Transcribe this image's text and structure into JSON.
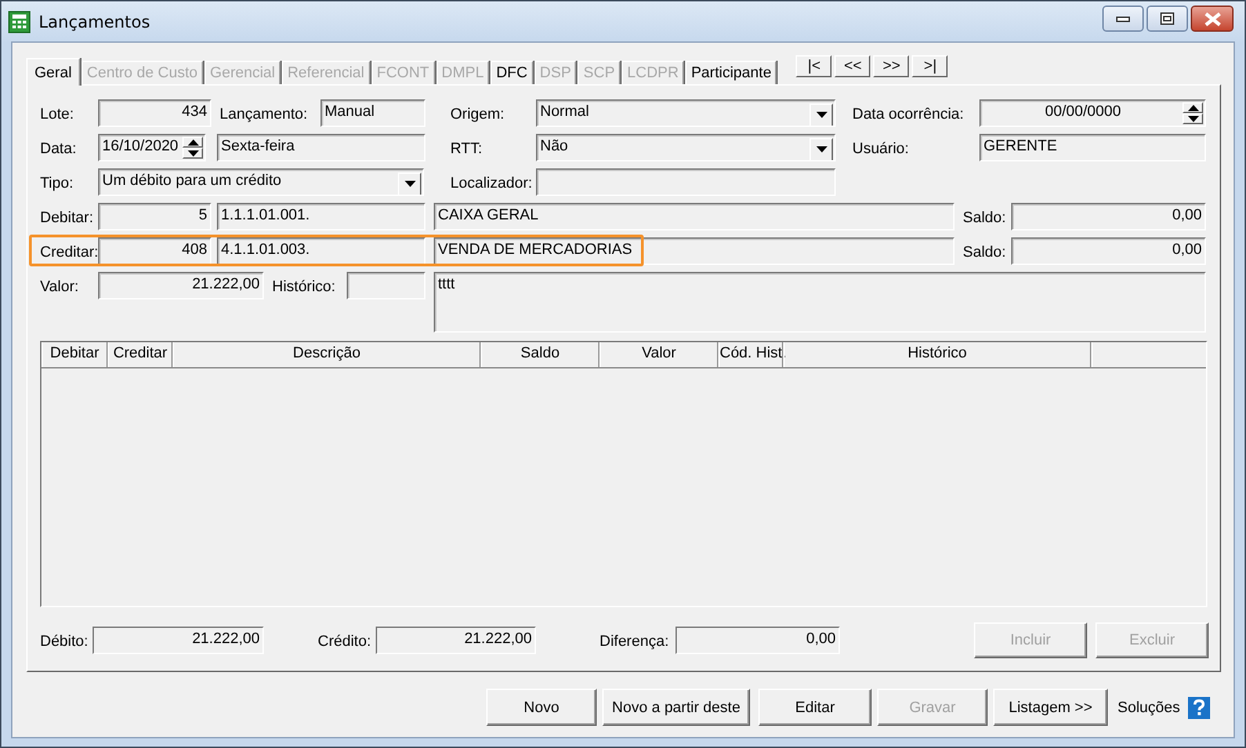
{
  "window": {
    "title": "Lançamentos"
  },
  "tabs": [
    {
      "label": "Geral",
      "selected": true,
      "disabled": false
    },
    {
      "label": "Centro de Custo",
      "selected": false,
      "disabled": true
    },
    {
      "label": "Gerencial",
      "selected": false,
      "disabled": true
    },
    {
      "label": "Referencial",
      "selected": false,
      "disabled": true
    },
    {
      "label": "FCONT",
      "selected": false,
      "disabled": true
    },
    {
      "label": "DMPL",
      "selected": false,
      "disabled": true
    },
    {
      "label": "DFC",
      "selected": false,
      "disabled": false
    },
    {
      "label": "DSP",
      "selected": false,
      "disabled": true
    },
    {
      "label": "SCP",
      "selected": false,
      "disabled": true
    },
    {
      "label": "LCDPR",
      "selected": false,
      "disabled": true
    },
    {
      "label": "Participante",
      "selected": false,
      "disabled": false
    }
  ],
  "nav_buttons": [
    "|<",
    "<<",
    ">>",
    ">|"
  ],
  "form_rows": [
    {
      "highlighted": false,
      "items": [
        {
          "kind": "label",
          "text": "Lote:"
        },
        {
          "kind": "field",
          "text": "434"
        },
        {
          "kind": "label",
          "text": "Lançamento:"
        },
        {
          "kind": "field",
          "text": "Manual"
        },
        {
          "kind": "label",
          "text": "Origem:"
        },
        {
          "kind": "select",
          "text": "Normal"
        },
        {
          "kind": "label",
          "text": "Data ocorrência:"
        },
        {
          "kind": "spin",
          "text": "00/00/0000"
        }
      ]
    },
    {
      "highlighted": false,
      "items": [
        {
          "kind": "label",
          "text": "Data:"
        },
        {
          "kind": "spin",
          "text": "16/10/2020"
        },
        {
          "kind": "field",
          "text": "Sexta-feira"
        },
        {
          "kind": "label",
          "text": "RTT:"
        },
        {
          "kind": "select",
          "text": "Não"
        },
        {
          "kind": "label",
          "text": "Usuário:"
        },
        {
          "kind": "field",
          "text": "GERENTE"
        }
      ]
    },
    {
      "highlighted": false,
      "items": [
        {
          "kind": "label",
          "text": "Tipo:"
        },
        {
          "kind": "select",
          "text": "Um débito para um crédito"
        },
        {
          "kind": "label",
          "text": "Localizador:"
        },
        {
          "kind": "field"
        }
      ]
    },
    {
      "highlighted": false,
      "items": [
        {
          "kind": "label",
          "text": "Debitar:"
        },
        {
          "kind": "field",
          "text": "5"
        },
        {
          "kind": "field",
          "text": "1.1.1.01.001."
        },
        {
          "kind": "field",
          "text": "CAIXA GERAL"
        },
        {
          "kind": "label",
          "text": "Saldo:"
        },
        {
          "kind": "field",
          "text": "0,00"
        }
      ]
    },
    {
      "highlighted": true,
      "items": [
        {
          "kind": "label",
          "text": "Creditar:"
        },
        {
          "kind": "field",
          "text": "408"
        },
        {
          "kind": "field",
          "text": "4.1.1.01.003."
        },
        {
          "kind": "field",
          "text": "VENDA DE MERCADORIAS"
        },
        {
          "kind": "label",
          "text": "Saldo:"
        },
        {
          "kind": "field",
          "text": "0,00"
        }
      ]
    },
    {
      "highlighted": false,
      "items": [
        {
          "kind": "label",
          "text": "Valor:"
        },
        {
          "kind": "field",
          "text": "21.222,00"
        },
        {
          "kind": "label",
          "text": "Histórico:"
        },
        {
          "kind": "field"
        },
        {
          "kind": "memo",
          "text": "tttt"
        }
      ]
    }
  ],
  "table": {
    "columns": [
      "Debitar",
      "Creditar",
      "Descrição",
      "Saldo",
      "Valor",
      "Cód. Hist.",
      "Histórico"
    ]
  },
  "totals": [
    {
      "label": "Débito:",
      "value": "21.222,00"
    },
    {
      "label": "Crédito:",
      "value": "21.222,00"
    },
    {
      "label": "Diferença:",
      "value": "0,00"
    }
  ],
  "row_buttons": [
    {
      "label": "Incluir",
      "disabled": true
    },
    {
      "label": "Excluir",
      "disabled": true
    }
  ],
  "footer_buttons": [
    {
      "label": "Novo",
      "disabled": false
    },
    {
      "label": "Novo a partir deste",
      "disabled": false
    },
    {
      "label": "Editar",
      "disabled": false
    },
    {
      "label": "Gravar",
      "disabled": true
    },
    {
      "label": "Listagem >>",
      "disabled": false
    }
  ],
  "help": {
    "label": "Soluções"
  }
}
